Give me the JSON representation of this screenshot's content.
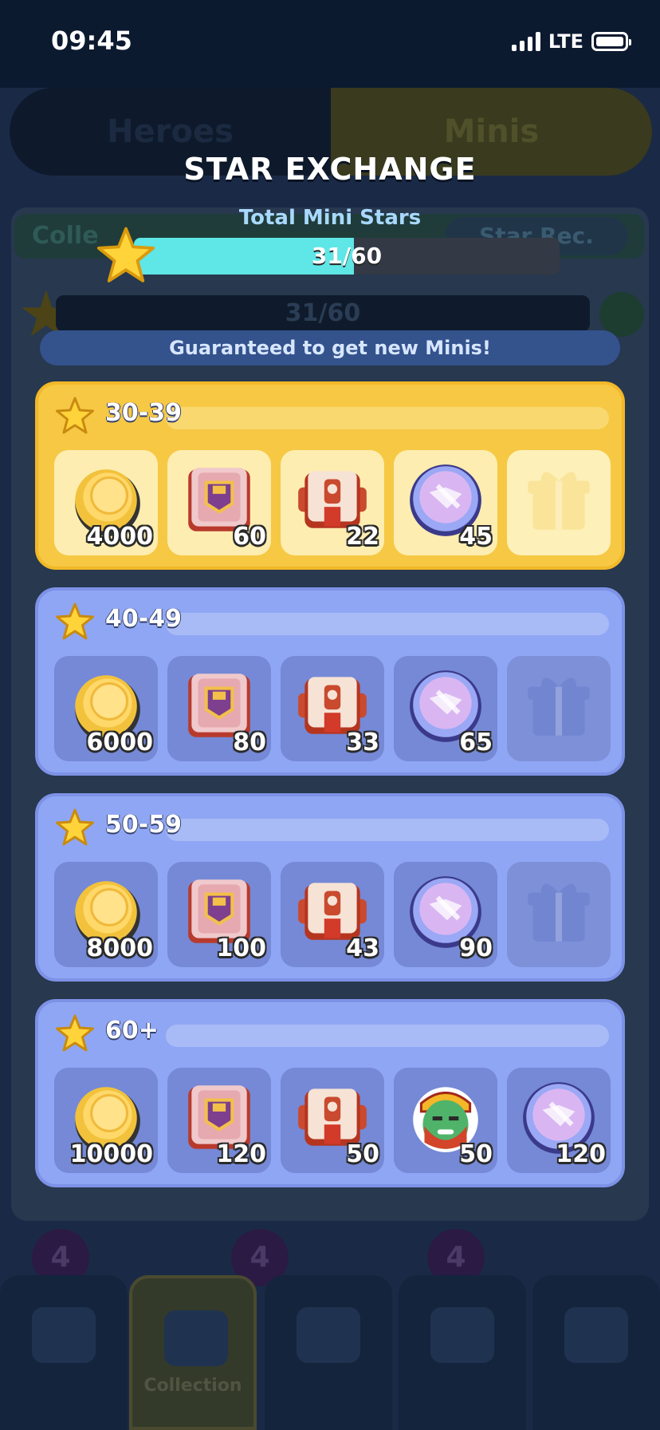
{
  "status": {
    "time": "09:45",
    "network": "LTE"
  },
  "background": {
    "tabs": [
      "Heroes",
      "Minis"
    ],
    "sub_left": "Colle",
    "sub_right": "Star Rec.",
    "bar_text": "31/60",
    "badges": [
      "4",
      "4",
      "4"
    ],
    "nav_active_label": "Collection"
  },
  "modal": {
    "title": "STAR EXCHANGE",
    "stars_label": "Total Mini Stars",
    "progress_text": "31/60",
    "progress_value": 31,
    "progress_max": 60,
    "guarantee": "Guaranteed to get new Minis!"
  },
  "tiers": [
    {
      "label": "30-39",
      "style": "gold",
      "rewards": [
        {
          "icon": "gold-coin-icon",
          "count": "4000"
        },
        {
          "icon": "pink-chest-icon",
          "count": "60"
        },
        {
          "icon": "red-chest-icon",
          "count": "22"
        },
        {
          "icon": "mini-token-icon",
          "count": "45"
        },
        {
          "icon": "gift-placeholder-icon",
          "count": ""
        }
      ]
    },
    {
      "label": "40-49",
      "style": "blue",
      "rewards": [
        {
          "icon": "gold-coin-icon",
          "count": "6000"
        },
        {
          "icon": "pink-chest-icon",
          "count": "80"
        },
        {
          "icon": "red-chest-icon",
          "count": "33"
        },
        {
          "icon": "mini-token-icon",
          "count": "65"
        },
        {
          "icon": "gift-placeholder-icon",
          "count": ""
        }
      ]
    },
    {
      "label": "50-59",
      "style": "blue",
      "rewards": [
        {
          "icon": "gold-coin-icon",
          "count": "8000"
        },
        {
          "icon": "pink-chest-icon",
          "count": "100"
        },
        {
          "icon": "red-chest-icon",
          "count": "43"
        },
        {
          "icon": "mini-token-icon",
          "count": "90"
        },
        {
          "icon": "gift-placeholder-icon",
          "count": ""
        }
      ]
    },
    {
      "label": "60+",
      "style": "blue",
      "rewards": [
        {
          "icon": "gold-coin-icon",
          "count": "10000"
        },
        {
          "icon": "pink-chest-icon",
          "count": "120"
        },
        {
          "icon": "red-chest-icon",
          "count": "50"
        },
        {
          "icon": "hero-portrait-icon",
          "count": "50"
        },
        {
          "icon": "mini-token-icon",
          "count": "120"
        }
      ]
    }
  ]
}
